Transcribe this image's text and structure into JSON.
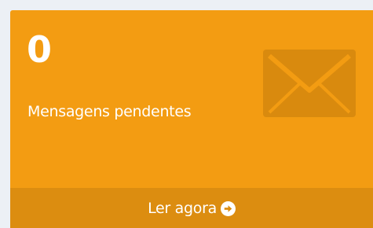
{
  "widget": {
    "count": "0",
    "label": "Mensagens pendentes",
    "icon": "envelope-icon",
    "footer_label": "Ler agora",
    "footer_icon": "arrow-circle-right-icon"
  },
  "colors": {
    "card_background": "#f39c12",
    "footer_background": "#dc8d10",
    "icon_color": "#d98a0e",
    "text": "#ffffff"
  }
}
